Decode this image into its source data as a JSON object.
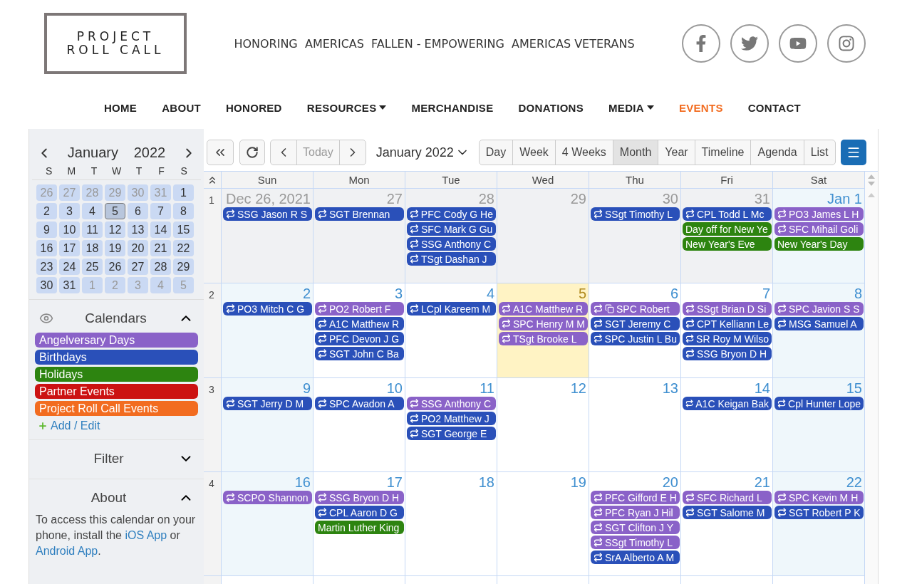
{
  "header": {
    "logo": [
      "PROJECT",
      "ROLL CALL"
    ],
    "tagline": "HONORING  AMERICAS  FALLEN - EMPOWERING  AMERICAS VETERANS"
  },
  "nav": [
    {
      "label": "HOME",
      "selected": false,
      "dropdown": false
    },
    {
      "label": "ABOUT",
      "selected": false,
      "dropdown": false
    },
    {
      "label": "HONORED",
      "selected": false,
      "dropdown": false
    },
    {
      "label": "RESOURCES",
      "selected": false,
      "dropdown": true
    },
    {
      "label": "MERCHANDISE",
      "selected": false,
      "dropdown": false
    },
    {
      "label": "DONATIONS",
      "selected": false,
      "dropdown": false
    },
    {
      "label": "MEDIA",
      "selected": false,
      "dropdown": true
    },
    {
      "label": "EVENTS",
      "selected": true,
      "dropdown": false
    },
    {
      "label": "CONTACT",
      "selected": false,
      "dropdown": false
    }
  ],
  "sidebar": {
    "mini": {
      "month": "January",
      "year": "2022",
      "weekdays": [
        "S",
        "M",
        "T",
        "W",
        "T",
        "F",
        "S"
      ],
      "days": [
        {
          "label": "26",
          "other": true,
          "selected": false
        },
        {
          "label": "27",
          "other": true,
          "selected": false
        },
        {
          "label": "28",
          "other": true,
          "selected": false
        },
        {
          "label": "29",
          "other": true,
          "selected": false
        },
        {
          "label": "30",
          "other": true,
          "selected": false
        },
        {
          "label": "31",
          "other": true,
          "selected": false
        },
        {
          "label": "1",
          "other": false,
          "selected": false
        },
        {
          "label": "2",
          "other": false,
          "selected": false
        },
        {
          "label": "3",
          "other": false,
          "selected": false
        },
        {
          "label": "4",
          "other": false,
          "selected": false
        },
        {
          "label": "5",
          "other": false,
          "selected": true
        },
        {
          "label": "6",
          "other": false,
          "selected": false
        },
        {
          "label": "7",
          "other": false,
          "selected": false
        },
        {
          "label": "8",
          "other": false,
          "selected": false
        },
        {
          "label": "9",
          "other": false,
          "selected": false
        },
        {
          "label": "10",
          "other": false,
          "selected": false
        },
        {
          "label": "11",
          "other": false,
          "selected": false
        },
        {
          "label": "12",
          "other": false,
          "selected": false
        },
        {
          "label": "13",
          "other": false,
          "selected": false
        },
        {
          "label": "14",
          "other": false,
          "selected": false
        },
        {
          "label": "15",
          "other": false,
          "selected": false
        },
        {
          "label": "16",
          "other": false,
          "selected": false
        },
        {
          "label": "17",
          "other": false,
          "selected": false
        },
        {
          "label": "18",
          "other": false,
          "selected": false
        },
        {
          "label": "19",
          "other": false,
          "selected": false
        },
        {
          "label": "20",
          "other": false,
          "selected": false
        },
        {
          "label": "21",
          "other": false,
          "selected": false
        },
        {
          "label": "22",
          "other": false,
          "selected": false
        },
        {
          "label": "23",
          "other": false,
          "selected": false
        },
        {
          "label": "24",
          "other": false,
          "selected": false
        },
        {
          "label": "25",
          "other": false,
          "selected": false
        },
        {
          "label": "26",
          "other": false,
          "selected": false
        },
        {
          "label": "27",
          "other": false,
          "selected": false
        },
        {
          "label": "28",
          "other": false,
          "selected": false
        },
        {
          "label": "29",
          "other": false,
          "selected": false
        },
        {
          "label": "30",
          "other": false,
          "selected": false
        },
        {
          "label": "31",
          "other": false,
          "selected": false
        },
        {
          "label": "1",
          "other": true,
          "selected": false
        },
        {
          "label": "2",
          "other": true,
          "selected": false
        },
        {
          "label": "3",
          "other": true,
          "selected": false
        },
        {
          "label": "4",
          "other": true,
          "selected": false
        },
        {
          "label": "5",
          "other": true,
          "selected": false
        }
      ]
    },
    "calendars": {
      "title": "Calendars",
      "expanded": true,
      "items": [
        {
          "label": "Angelversary Days",
          "color": "#8a62c8"
        },
        {
          "label": "Birthdays",
          "color": "#2a50b9"
        },
        {
          "label": "Holidays",
          "color": "#2d8410"
        },
        {
          "label": "Partner Events",
          "color": "#cc1212"
        },
        {
          "label": "Project Roll Call Events",
          "color": "#f26c20"
        }
      ],
      "add_edit": "Add / Edit"
    },
    "filter": {
      "title": "Filter",
      "expanded": false
    },
    "about": {
      "title": "About",
      "expanded": true,
      "text": "To access this calendar on your phone, install the ",
      "link1": "iOS App",
      "middle": " or ",
      "link2": "Android App",
      "end": "."
    }
  },
  "toolbar": {
    "today": {
      "label": "Today",
      "disabled": true
    },
    "title": "January 2022",
    "views": [
      {
        "label": "Day",
        "selected": false
      },
      {
        "label": "Week",
        "selected": false
      },
      {
        "label": "4 Weeks",
        "selected": false
      },
      {
        "label": "Month",
        "selected": true
      },
      {
        "label": "Year",
        "selected": false
      },
      {
        "label": "Timeline",
        "selected": false
      },
      {
        "label": "Agenda",
        "selected": false
      },
      {
        "label": "List",
        "selected": false
      }
    ]
  },
  "grid": {
    "weekdays": [
      "Sun",
      "Mon",
      "Tue",
      "Wed",
      "Thu",
      "Fri",
      "Sat"
    ],
    "weeks": [
      {
        "number": "1",
        "days": [
          {
            "label": "Dec 26, 2021",
            "kind": "other",
            "events": [
              {
                "label": "SSG Jason R S",
                "color": "#2a50b9",
                "repeat": true,
                "duplicate": false
              }
            ]
          },
          {
            "label": "27",
            "kind": "other",
            "events": [
              {
                "label": "SGT Brennan",
                "color": "#2a50b9",
                "repeat": true,
                "duplicate": false
              }
            ]
          },
          {
            "label": "28",
            "kind": "other",
            "events": [
              {
                "label": "PFC Cody G He",
                "color": "#2a50b9",
                "repeat": true,
                "duplicate": false
              },
              {
                "label": "SFC Mark G Gu",
                "color": "#2a50b9",
                "repeat": true,
                "duplicate": false
              },
              {
                "label": "SSG Anthony C",
                "color": "#2a50b9",
                "repeat": true,
                "duplicate": false
              },
              {
                "label": "TSgt Dashan J",
                "color": "#2a50b9",
                "repeat": true,
                "duplicate": false
              }
            ]
          },
          {
            "label": "29",
            "kind": "other"
          },
          {
            "label": "30",
            "kind": "other",
            "events": [
              {
                "label": "SSgt Timothy L",
                "color": "#2a50b9",
                "repeat": true,
                "duplicate": false
              }
            ]
          },
          {
            "label": "31",
            "kind": "other",
            "events": [
              {
                "label": "CPL Todd L Mc",
                "color": "#2a50b9",
                "repeat": true,
                "duplicate": false
              },
              {
                "label": "Day off for New Ye",
                "color": "#2d8410",
                "repeat": false,
                "duplicate": false
              },
              {
                "label": "New Year's Eve",
                "color": "#2d8410",
                "repeat": false,
                "duplicate": false
              }
            ]
          },
          {
            "label": "Jan 1",
            "kind": "weekend",
            "events": [
              {
                "label": "PO3 James L H",
                "color": "#8a62c8",
                "repeat": true,
                "duplicate": false
              },
              {
                "label": "SFC Mihail Goli",
                "color": "#8a62c8",
                "repeat": true,
                "duplicate": false
              },
              {
                "label": "New Year's Day",
                "color": "#2d8410",
                "repeat": false,
                "duplicate": false
              }
            ]
          }
        ]
      },
      {
        "number": "2",
        "days": [
          {
            "label": "2",
            "kind": "weekend",
            "events": [
              {
                "label": "PO3 Mitch C G",
                "color": "#2a50b9",
                "repeat": true,
                "duplicate": false
              }
            ]
          },
          {
            "label": "3",
            "kind": "normal",
            "events": [
              {
                "label": "PO2 Robert F",
                "color": "#8a62c8",
                "repeat": true,
                "duplicate": false
              },
              {
                "label": "A1C Matthew R",
                "color": "#2a50b9",
                "repeat": true,
                "duplicate": false
              },
              {
                "label": "PFC Devon J G",
                "color": "#2a50b9",
                "repeat": true,
                "duplicate": false
              },
              {
                "label": "SGT John C Ba",
                "color": "#2a50b9",
                "repeat": true,
                "duplicate": false
              }
            ]
          },
          {
            "label": "4",
            "kind": "normal",
            "events": [
              {
                "label": "LCpl Kareem M",
                "color": "#2a50b9",
                "repeat": true,
                "duplicate": false
              }
            ]
          },
          {
            "label": "5",
            "kind": "today",
            "events": [
              {
                "label": "A1C Matthew R",
                "color": "#8a62c8",
                "repeat": true,
                "duplicate": false
              },
              {
                "label": "SPC Henry M M",
                "color": "#8a62c8",
                "repeat": true,
                "duplicate": false
              },
              {
                "label": "TSgt Brooke L",
                "color": "#8a62c8",
                "repeat": true,
                "duplicate": false
              }
            ]
          },
          {
            "label": "6",
            "kind": "normal",
            "events": [
              {
                "label": "SPC Robert",
                "color": "#8a62c8",
                "repeat": true,
                "duplicate": true
              },
              {
                "label": "SGT Jeremy C",
                "color": "#2a50b9",
                "repeat": true,
                "duplicate": false
              },
              {
                "label": "SPC Justin L Bu",
                "color": "#2a50b9",
                "repeat": true,
                "duplicate": false
              }
            ]
          },
          {
            "label": "7",
            "kind": "normal",
            "events": [
              {
                "label": "SSgt Brian D Si",
                "color": "#8a62c8",
                "repeat": true,
                "duplicate": false
              },
              {
                "label": "CPT Kelliann Le",
                "color": "#2a50b9",
                "repeat": true,
                "duplicate": false
              },
              {
                "label": "SR Roy M Wilso",
                "color": "#2a50b9",
                "repeat": true,
                "duplicate": false
              },
              {
                "label": "SSG Bryon D H",
                "color": "#2a50b9",
                "repeat": true,
                "duplicate": false
              }
            ]
          },
          {
            "label": "8",
            "kind": "weekend",
            "events": [
              {
                "label": "SPC Javion S S",
                "color": "#8a62c8",
                "repeat": true,
                "duplicate": false
              },
              {
                "label": "MSG Samuel A",
                "color": "#2a50b9",
                "repeat": true,
                "duplicate": false
              }
            ]
          }
        ]
      },
      {
        "number": "3",
        "days": [
          {
            "label": "9",
            "kind": "weekend",
            "events": [
              {
                "label": "SGT Jerry D M",
                "color": "#2a50b9",
                "repeat": true,
                "duplicate": false
              }
            ]
          },
          {
            "label": "10",
            "kind": "normal",
            "events": [
              {
                "label": "SPC Avadon A",
                "color": "#2a50b9",
                "repeat": true,
                "duplicate": false
              }
            ]
          },
          {
            "label": "11",
            "kind": "normal",
            "events": [
              {
                "label": "SSG Anthony C",
                "color": "#8a62c8",
                "repeat": true,
                "duplicate": false
              },
              {
                "label": "PO2 Matthew J",
                "color": "#2a50b9",
                "repeat": true,
                "duplicate": false
              },
              {
                "label": "SGT George E",
                "color": "#2a50b9",
                "repeat": true,
                "duplicate": false
              }
            ]
          },
          {
            "label": "12",
            "kind": "normal"
          },
          {
            "label": "13",
            "kind": "normal"
          },
          {
            "label": "14",
            "kind": "normal",
            "events": [
              {
                "label": "A1C Keigan Bak",
                "color": "#2a50b9",
                "repeat": true,
                "duplicate": false
              }
            ]
          },
          {
            "label": "15",
            "kind": "weekend",
            "events": [
              {
                "label": "Cpl Hunter Lope",
                "color": "#2a50b9",
                "repeat": true,
                "duplicate": false
              }
            ]
          }
        ]
      },
      {
        "number": "4",
        "days": [
          {
            "label": "16",
            "kind": "weekend",
            "events": [
              {
                "label": "SCPO Shannon",
                "color": "#8a62c8",
                "repeat": true,
                "duplicate": false
              }
            ]
          },
          {
            "label": "17",
            "kind": "normal",
            "events": [
              {
                "label": "SSG Bryon D H",
                "color": "#8a62c8",
                "repeat": true,
                "duplicate": false
              },
              {
                "label": "CPL Aaron D G",
                "color": "#2a50b9",
                "repeat": true,
                "duplicate": false
              },
              {
                "label": "Martin Luther King",
                "color": "#2d8410",
                "repeat": false,
                "duplicate": false
              }
            ]
          },
          {
            "label": "18",
            "kind": "normal"
          },
          {
            "label": "19",
            "kind": "normal"
          },
          {
            "label": "20",
            "kind": "normal",
            "events": [
              {
                "label": "PFC Gifford E H",
                "color": "#8a62c8",
                "repeat": true,
                "duplicate": false
              },
              {
                "label": "PFC Ryan J Hil",
                "color": "#8a62c8",
                "repeat": true,
                "duplicate": false
              },
              {
                "label": "SGT Clifton J Y",
                "color": "#8a62c8",
                "repeat": true,
                "duplicate": false
              },
              {
                "label": "SSgt Timothy L",
                "color": "#8a62c8",
                "repeat": true,
                "duplicate": false
              },
              {
                "label": "SrA Alberto A M",
                "color": "#2a50b9",
                "repeat": true,
                "duplicate": false
              }
            ]
          },
          {
            "label": "21",
            "kind": "normal",
            "events": [
              {
                "label": "SFC Richard L",
                "color": "#8a62c8",
                "repeat": true,
                "duplicate": false
              },
              {
                "label": "SGT Salome M",
                "color": "#2a50b9",
                "repeat": true,
                "duplicate": false
              }
            ]
          },
          {
            "label": "22",
            "kind": "weekend",
            "events": [
              {
                "label": "SPC Kevin M H",
                "color": "#8a62c8",
                "repeat": true,
                "duplicate": false
              },
              {
                "label": "SGT Robert P K",
                "color": "#2a50b9",
                "repeat": true,
                "duplicate": false
              }
            ]
          }
        ]
      }
    ]
  }
}
